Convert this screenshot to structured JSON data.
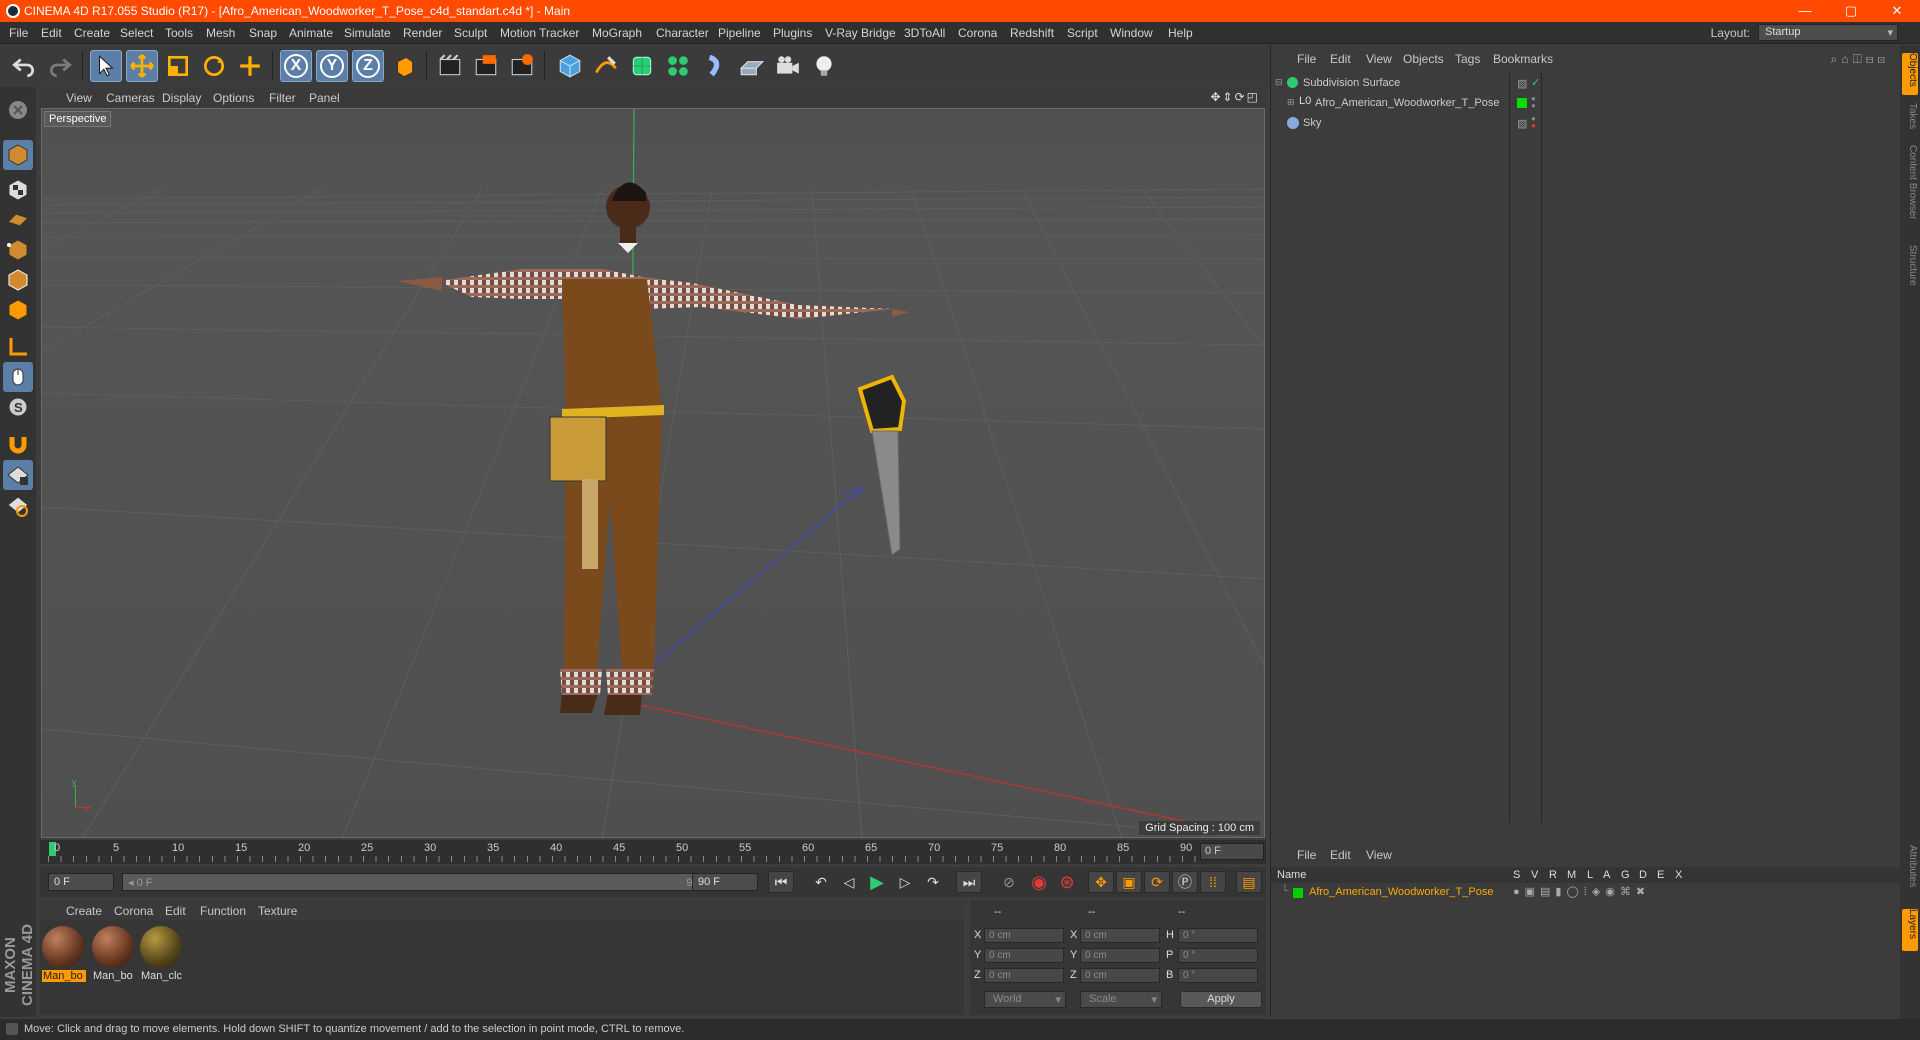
{
  "app": {
    "title": "CINEMA 4D R17.055 Studio (R17) - [Afro_American_Woodworker_T_Pose_c4d_standart.c4d *] - Main",
    "window_controls": [
      "—",
      "▢",
      "✕"
    ]
  },
  "menubar": {
    "items": [
      "File",
      "Edit",
      "Create",
      "Select",
      "Tools",
      "Mesh",
      "Snap",
      "Animate",
      "Simulate",
      "Render",
      "Sculpt",
      "Motion Tracker",
      "MoGraph",
      "Character",
      "Pipeline",
      "Plugins",
      "V-Ray Bridge",
      "3DToAll",
      "Corona",
      "Redshift",
      "Script",
      "Window",
      "Help"
    ],
    "layout_label": "Layout:",
    "layout_value": "Startup"
  },
  "toolbar": {
    "axis_x": "X",
    "axis_y": "Y",
    "axis_z": "Z"
  },
  "viewport": {
    "menu": [
      "View",
      "Cameras",
      "Display",
      "Options",
      "Filter",
      "Panel"
    ],
    "camera_label": "Perspective",
    "grid_spacing": "Grid Spacing : 100 cm",
    "axis_y": "y",
    "axis_x": "x"
  },
  "timeline": {
    "ticks": [
      "0",
      "5",
      "10",
      "15",
      "20",
      "25",
      "30",
      "35",
      "40",
      "45",
      "50",
      "55",
      "60",
      "65",
      "70",
      "75",
      "80",
      "85",
      "90"
    ],
    "current_frame": "0 F"
  },
  "transport": {
    "start_frame": "0 F",
    "range_start": "◂ 0 F",
    "range_end": "90 F ▸",
    "end_frame": "90 F"
  },
  "materials": {
    "menu": [
      "Create",
      "Corona",
      "Edit",
      "Function",
      "Texture"
    ],
    "items": [
      {
        "label": "Man_bo",
        "color": "#6b3a22",
        "selected": true
      },
      {
        "label": "Man_bo",
        "color": "#6b3a22",
        "selected": false
      },
      {
        "label": "Man_clc",
        "color": "#5a4a1c",
        "selected": false
      }
    ]
  },
  "coordinates": {
    "headers": [
      "--",
      "--",
      "--"
    ],
    "rows": [
      {
        "axis": "X",
        "pos": "0 cm",
        "axis2": "X",
        "size": "0 cm",
        "rot_label": "H",
        "rot": "0 °"
      },
      {
        "axis": "Y",
        "pos": "0 cm",
        "axis2": "Y",
        "size": "0 cm",
        "rot_label": "P",
        "rot": "0 °"
      },
      {
        "axis": "Z",
        "pos": "0 cm",
        "axis2": "Z",
        "size": "0 cm",
        "rot_label": "B",
        "rot": "0 °"
      }
    ],
    "mode_world": "World",
    "mode_scale": "Scale",
    "apply": "Apply"
  },
  "objects_panel": {
    "menu": [
      "File",
      "Edit",
      "View",
      "Objects",
      "Tags",
      "Bookmarks"
    ],
    "items": [
      {
        "name": "Subdivision Surface",
        "color": "#2ecc71",
        "indent": 0
      },
      {
        "name": "Afro_American_Woodworker_T_Pose",
        "color": "#cccccc",
        "indent": 1
      },
      {
        "name": "Sky",
        "color": "#88aadd",
        "indent": 0
      }
    ]
  },
  "layers_panel": {
    "menu": [
      "File",
      "Edit",
      "View"
    ],
    "columns": [
      "Name",
      "S",
      "V",
      "R",
      "M",
      "L",
      "A",
      "G",
      "D",
      "E",
      "X"
    ],
    "layer_name": "Afro_American_Woodworker_T_Pose",
    "layer_color": "#00d000"
  },
  "right_tabs": [
    "Objects",
    "Takes",
    "Content Browser",
    "Structure",
    "Attributes",
    "Layers"
  ],
  "logo": "MAXON CINEMA 4D",
  "status": "Move: Click and drag to move elements. Hold down SHIFT to quantize movement / add to the selection in point mode, CTRL to remove.",
  "colors": {
    "titlebar": "#ff4a00",
    "accent": "#ff9a00",
    "selection": "#5c7fa8"
  }
}
